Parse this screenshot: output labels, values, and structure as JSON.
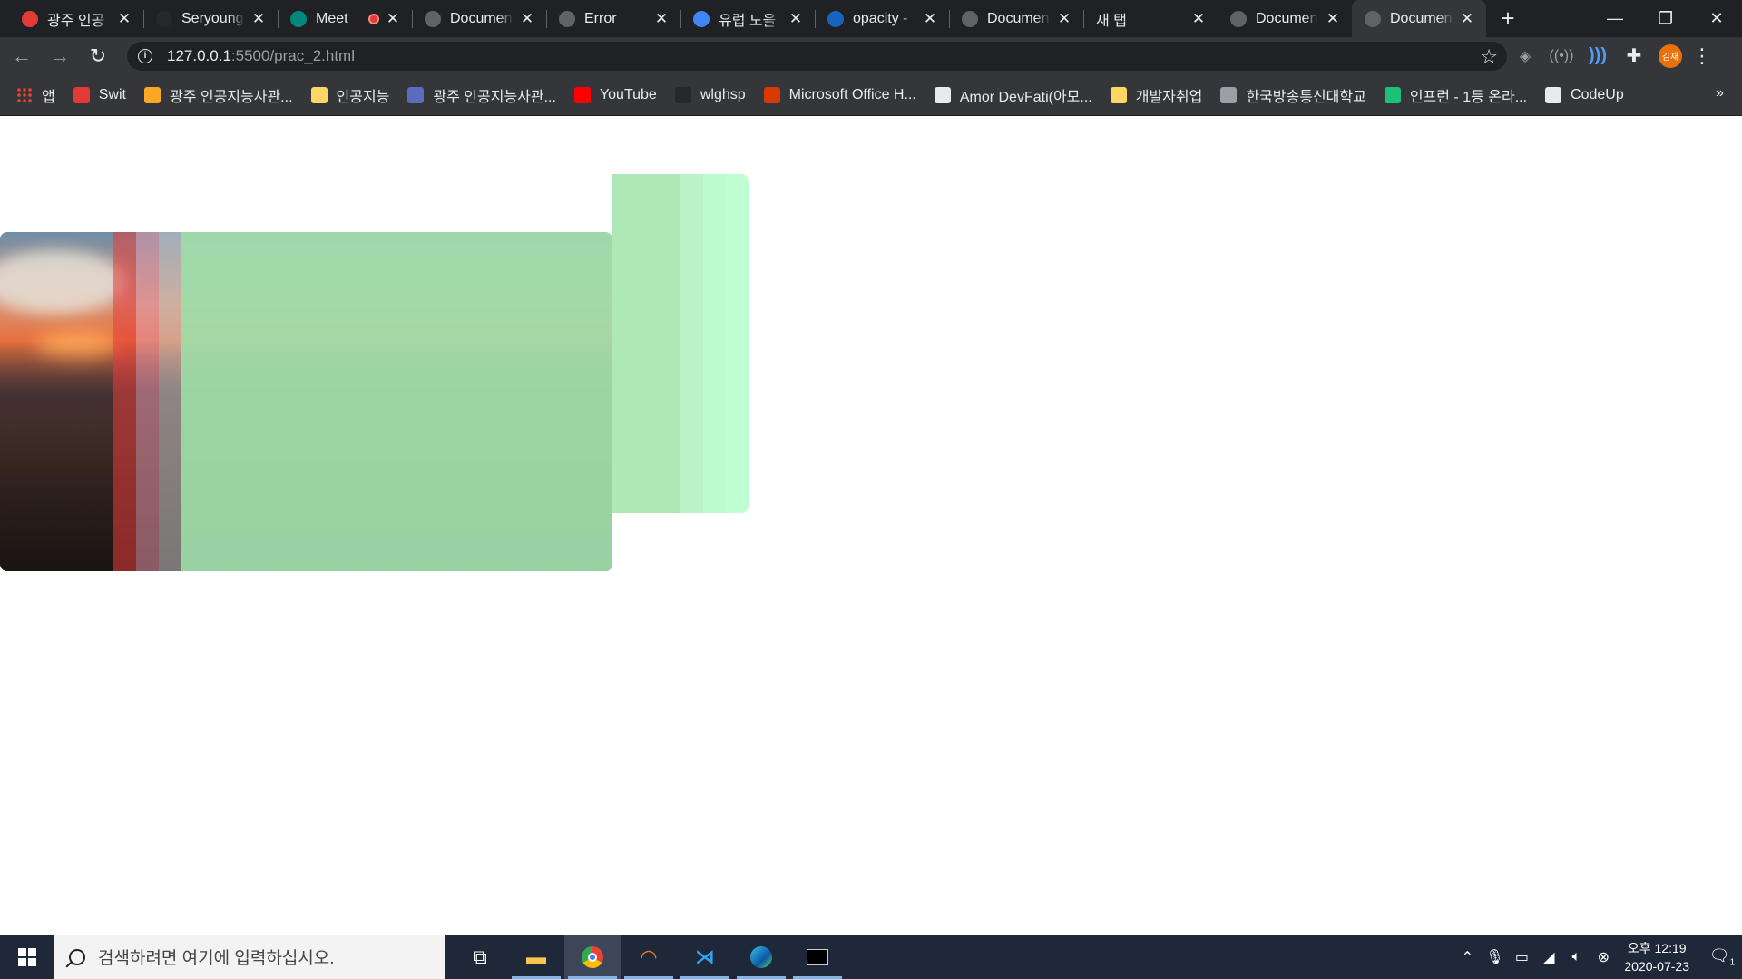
{
  "browser": {
    "tabs": [
      {
        "title": "광주 인공",
        "icon": "swit-icon",
        "color": "#e53935"
      },
      {
        "title": "Seryoung",
        "icon": "github-icon",
        "color": "#24292e"
      },
      {
        "title": "Meet",
        "icon": "meet-icon",
        "color": "#00897b",
        "recording": true
      },
      {
        "title": "Document",
        "icon": "globe-icon",
        "color": "#5f6368"
      },
      {
        "title": "Error",
        "icon": "globe-icon",
        "color": "#5f6368"
      },
      {
        "title": "유럽 노을",
        "icon": "google-icon",
        "color": "#4285f4"
      },
      {
        "title": "opacity -",
        "icon": "mdn-icon",
        "color": "#1565c0"
      },
      {
        "title": "Document",
        "icon": "globe-icon",
        "color": "#5f6368"
      },
      {
        "title": "새 탭",
        "icon": "",
        "color": ""
      },
      {
        "title": "Document",
        "icon": "globe-icon",
        "color": "#5f6368"
      },
      {
        "title": "Document",
        "icon": "globe-icon",
        "color": "#5f6368",
        "active": true
      }
    ],
    "new_tab_symbol": "+",
    "window_controls": {
      "minimize": "—",
      "restore": "❐",
      "close": "✕"
    },
    "nav": {
      "back": "←",
      "forward": "→",
      "reload": "↻"
    },
    "url": {
      "host": "127.0.0.1",
      "rest": ":5500/prac_2.html"
    },
    "star": "☆",
    "profile_initials": "김재",
    "bookmarks": [
      {
        "label": "앱",
        "icon": "apps-grid-icon",
        "color": "#ea4335"
      },
      {
        "label": "Swit",
        "icon": "swit-icon",
        "color": "#e53935"
      },
      {
        "label": "광주 인공지능사관...",
        "icon": "slash-icon",
        "color": "#f9a825"
      },
      {
        "label": "인공지능",
        "icon": "folder-icon",
        "color": "#fdd663"
      },
      {
        "label": "광주 인공지능사관...",
        "icon": "slash-icon",
        "color": "#5c6bc0"
      },
      {
        "label": "YouTube",
        "icon": "youtube-icon",
        "color": "#ff0000"
      },
      {
        "label": "wlghsp",
        "icon": "github-icon",
        "color": "#24292e"
      },
      {
        "label": "Microsoft Office H...",
        "icon": "office-icon",
        "color": "#d83b01"
      },
      {
        "label": "Amor DevFati(아모...",
        "icon": "dots-icon",
        "color": "#e8eaed"
      },
      {
        "label": "개발자취업",
        "icon": "folder-icon",
        "color": "#fdd663"
      },
      {
        "label": "한국방송통신대학교",
        "icon": "globe-icon",
        "color": "#9aa0a6"
      },
      {
        "label": "인프런 - 1등 온라...",
        "icon": "inflearn-icon",
        "color": "#1dc078"
      },
      {
        "label": "CodeUp",
        "icon": "codeup-icon",
        "color": "#e8eaed"
      }
    ],
    "bookmarks_more": "»"
  },
  "taskbar": {
    "search_placeholder": "검색하려면 여기에 입력하십시오.",
    "clock_time": "오후 12:19",
    "clock_date": "2020-07-23",
    "notification_count": "1"
  }
}
